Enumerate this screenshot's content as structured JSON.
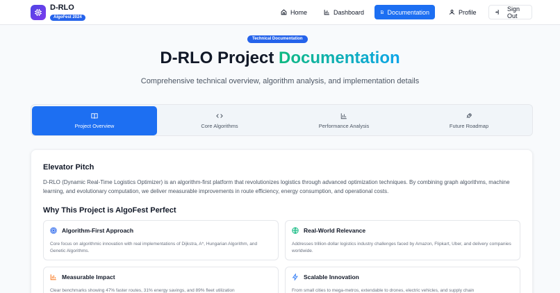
{
  "header": {
    "app_title": "D-RLO",
    "badge": "AlgoFest 2024",
    "nav": [
      {
        "label": "Home",
        "icon": "home-icon"
      },
      {
        "label": "Dashboard",
        "icon": "bar-chart-icon"
      },
      {
        "label": "Documentation",
        "icon": "document-icon",
        "active": true
      },
      {
        "label": "Profile",
        "icon": "user-icon"
      },
      {
        "label": "Sign Out",
        "icon": "sign-out-icon"
      }
    ]
  },
  "hero": {
    "badge": "Technical Documentation",
    "title_main": "D-RLO Project ",
    "title_accent": "Documentation",
    "subtitle": "Comprehensive technical overview, algorithm analysis, and implementation details"
  },
  "tabs": [
    {
      "label": "Project Overview",
      "icon": "book-icon",
      "active": true
    },
    {
      "label": "Core Algorithms",
      "icon": "code-icon"
    },
    {
      "label": "Performance Analysis",
      "icon": "bar-chart-icon"
    },
    {
      "label": "Future Roadmap",
      "icon": "rocket-icon"
    }
  ],
  "content": {
    "pitch_title": "Elevator Pitch",
    "pitch_text": "D-RLO (Dynamic Real-Time Logistics Optimizer) is an algorithm-first platform that revolutionizes logistics through advanced optimization techniques. By combining graph algorithms, machine learning, and evolutionary computation, we deliver measurable improvements in route efficiency, energy consumption, and operational costs.",
    "why_title": "Why This Project is AlgoFest Perfect",
    "features": [
      {
        "title": "Algorithm-First Approach",
        "icon": "target-icon",
        "desc": "Core focus on algorithmic innovation with real implementations of Dijkstra, A*, Hungarian Algorithm, and Genetic Algorithms."
      },
      {
        "title": "Real-World Relevance",
        "icon": "globe-icon",
        "desc": "Addresses trillion-dollar logistics industry challenges faced by Amazon, Flipkart, Uber, and delivery companies worldwide."
      },
      {
        "title": "Measurable Impact",
        "icon": "bar-chart-icon",
        "desc": "Clear benchmarks showing 47% faster routes, 31% energy savings, and 89% fleet utilization"
      },
      {
        "title": "Scalable Innovation",
        "icon": "lightning-icon",
        "desc": "From small cities to mega-metros, extendable to drones, electric vehicles, and supply chain"
      }
    ]
  },
  "colors": {
    "primary": "#1d6ff2",
    "accent_green": "#10b981",
    "accent_blue": "#0ea5e9",
    "logo": "#4f46e5",
    "target_icon": "#2563eb",
    "globe_icon": "#10b981",
    "chart_icon": "#f97316",
    "lightning_icon": "#3b82f6"
  }
}
